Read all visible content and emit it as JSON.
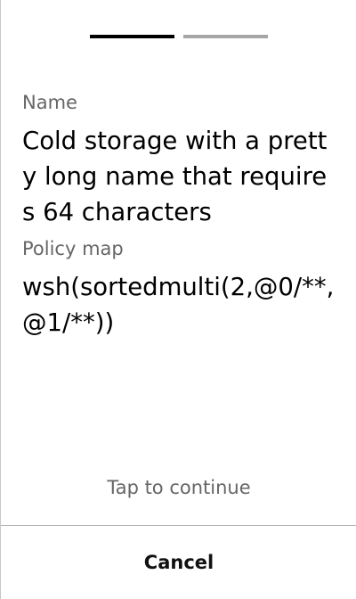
{
  "progress": {
    "steps": 2,
    "active_step": 1,
    "active_color": "#000000",
    "inactive_color": "#a6a6a6"
  },
  "name": {
    "label": "Name",
    "value": "Cold storage with a pretty long name that requires 64 characters"
  },
  "policy": {
    "label": "Policy map",
    "value": "wsh(sortedmulti(2,@0/**,@1/**))"
  },
  "continue_label": "Tap to continue",
  "cancel_label": "Cancel"
}
